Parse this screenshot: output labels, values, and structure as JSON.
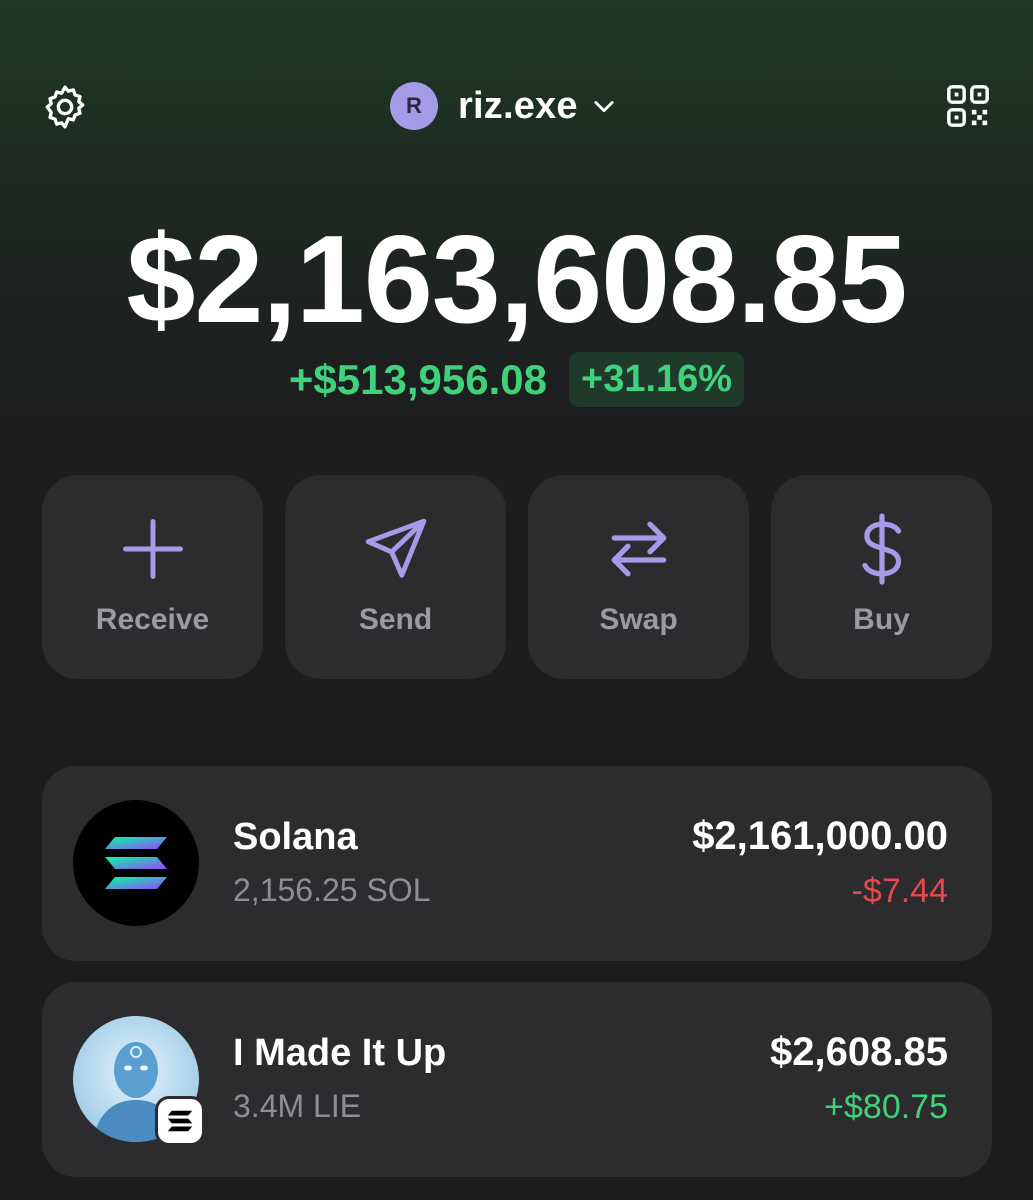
{
  "header": {
    "account_initial": "R",
    "account_name": "riz.exe",
    "icons": {
      "settings": "gear-icon",
      "switcher": "chevron-down-icon",
      "qr": "qr-code-icon"
    }
  },
  "portfolio": {
    "balance": "$2,163,608.85",
    "change_amount": "+$513,956.08",
    "change_percent": "+31.16%"
  },
  "actions": [
    {
      "label": "Receive",
      "icon": "plus-icon"
    },
    {
      "label": "Send",
      "icon": "send-icon"
    },
    {
      "label": "Swap",
      "icon": "swap-arrows-icon"
    },
    {
      "label": "Buy",
      "icon": "dollar-icon"
    }
  ],
  "tokens": [
    {
      "name": "Solana",
      "quantity": "2,156.25 SOL",
      "value": "$2,161,000.00",
      "change": "-$7.44",
      "change_direction": "negative"
    },
    {
      "name": "I Made It Up",
      "quantity": "3.4M LIE",
      "value": "$2,608.85",
      "change": "+$80.75",
      "change_direction": "positive"
    }
  ],
  "colors": {
    "accent": "#a59be8",
    "positive": "#3fd27a",
    "negative": "#e5484d",
    "card": "#2c2c2e",
    "background": "#1c1c1e"
  }
}
